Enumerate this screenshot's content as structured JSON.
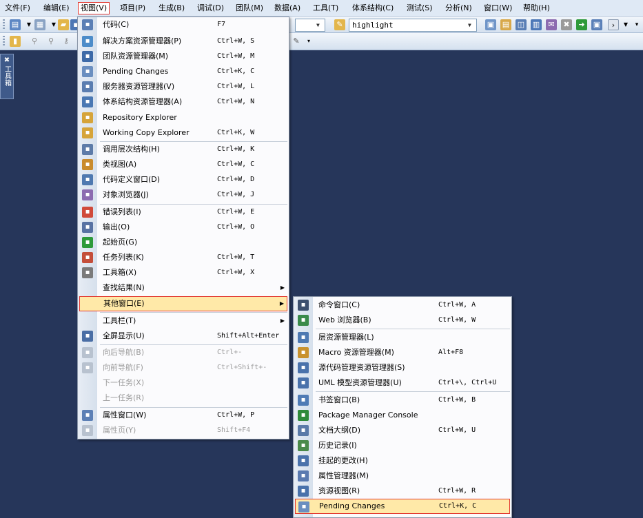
{
  "menubar": {
    "items": [
      "文件(F)",
      "编辑(E)",
      "视图(V)",
      "项目(P)",
      "生成(B)",
      "调试(D)",
      "团队(M)",
      "数据(A)",
      "工具(T)",
      "体系结构(C)",
      "测试(S)",
      "分析(N)",
      "窗口(W)",
      "帮助(H)"
    ]
  },
  "toolbar": {
    "find_value": "highlight",
    "first_combo_value": ""
  },
  "toolbox_tab": "工具箱",
  "view_menu": {
    "items": [
      {
        "label": "代码(C)",
        "shortcut": "F7",
        "icon": "code-icon",
        "color": "#5b7fb5"
      },
      {
        "label": "解决方案资源管理器(P)",
        "shortcut": "Ctrl+W, S",
        "icon": "solution-explorer-icon",
        "color": "#4d8cc9"
      },
      {
        "label": "团队资源管理器(M)",
        "shortcut": "Ctrl+W, M",
        "icon": "team-explorer-icon",
        "color": "#3d6aa8"
      },
      {
        "label": "Pending Changes",
        "shortcut": "Ctrl+K, C",
        "icon": "pending-changes-icon",
        "color": "#6b8fc0"
      },
      {
        "label": "服务器资源管理器(V)",
        "shortcut": "Ctrl+W, L",
        "icon": "server-explorer-icon",
        "color": "#5a7db0"
      },
      {
        "label": "体系结构资源管理器(A)",
        "shortcut": "Ctrl+W, N",
        "icon": "architecture-explorer-icon",
        "color": "#4a78b3"
      },
      {
        "label": "Repository Explorer",
        "shortcut": "",
        "icon": "repository-explorer-icon",
        "color": "#d6a43a"
      },
      {
        "label": "Working Copy Explorer",
        "shortcut": "Ctrl+K, W",
        "icon": "working-copy-icon",
        "color": "#d6a43a"
      },
      {
        "label": "调用层次结构(H)",
        "shortcut": "Ctrl+W, K",
        "icon": "call-hierarchy-icon",
        "color": "#5d7ba8"
      },
      {
        "label": "类视图(A)",
        "shortcut": "Ctrl+W, C",
        "icon": "class-view-icon",
        "color": "#c98b2d"
      },
      {
        "label": "代码定义窗口(D)",
        "shortcut": "Ctrl+W, D",
        "icon": "code-definition-icon",
        "color": "#4f79b0"
      },
      {
        "label": "对象浏览器(J)",
        "shortcut": "Ctrl+W, J",
        "icon": "object-browser-icon",
        "color": "#8c6bb0"
      },
      {
        "label": "错误列表(I)",
        "shortcut": "Ctrl+W, E",
        "icon": "error-list-icon",
        "color": "#d04a3a"
      },
      {
        "label": "输出(O)",
        "shortcut": "Ctrl+W, O",
        "icon": "output-icon",
        "color": "#5872a3"
      },
      {
        "label": "起始页(G)",
        "shortcut": "",
        "icon": "start-page-icon",
        "color": "#2e9a3a"
      },
      {
        "label": "任务列表(K)",
        "shortcut": "Ctrl+W, T",
        "icon": "task-list-icon",
        "color": "#c44e3a"
      },
      {
        "label": "工具箱(X)",
        "shortcut": "Ctrl+W, X",
        "icon": "toolbox-icon",
        "color": "#7a7a7a"
      },
      {
        "label": "查找结果(N)",
        "shortcut": "",
        "icon": "",
        "color": ""
      },
      {
        "label": "其他窗口(E)",
        "shortcut": "",
        "icon": "",
        "color": ""
      },
      {
        "label": "工具栏(T)",
        "shortcut": "",
        "icon": "",
        "color": ""
      },
      {
        "label": "全屏显示(U)",
        "shortcut": "Shift+Alt+Enter",
        "icon": "full-screen-icon",
        "color": "#4a6ea5"
      },
      {
        "label": "向后导航(B)",
        "shortcut": "Ctrl+-",
        "icon": "navigate-back-icon",
        "color": "#b8c2cf"
      },
      {
        "label": "向前导航(F)",
        "shortcut": "Ctrl+Shift+-",
        "icon": "navigate-forward-icon",
        "color": "#b8c2cf"
      },
      {
        "label": "下一任务(X)",
        "shortcut": "",
        "icon": "",
        "color": ""
      },
      {
        "label": "上一任务(R)",
        "shortcut": "",
        "icon": "",
        "color": ""
      },
      {
        "label": "属性窗口(W)",
        "shortcut": "Ctrl+W, P",
        "icon": "properties-window-icon",
        "color": "#5d80b5"
      },
      {
        "label": "属性页(Y)",
        "shortcut": "Shift+F4",
        "icon": "property-pages-icon",
        "color": "#b8c2cf"
      }
    ]
  },
  "other_windows_menu": {
    "items": [
      {
        "label": "命令窗口(C)",
        "shortcut": "Ctrl+W, A",
        "icon": "command-window-icon",
        "color": "#3c4f6e"
      },
      {
        "label": "Web 浏览器(B)",
        "shortcut": "Ctrl+W, W",
        "icon": "web-browser-icon",
        "color": "#3a8a4a"
      },
      {
        "label": "层资源管理器(L)",
        "shortcut": "",
        "icon": "layer-explorer-icon",
        "color": "#4e79b2"
      },
      {
        "label": "Macro 资源管理器(M)",
        "shortcut": "Alt+F8",
        "icon": "macro-explorer-icon",
        "color": "#c9922e"
      },
      {
        "label": "源代码管理资源管理器(S)",
        "shortcut": "",
        "icon": "source-control-icon",
        "color": "#4a72ab"
      },
      {
        "label": "UML 模型资源管理器(U)",
        "shortcut": "Ctrl+\\, Ctrl+U",
        "icon": "uml-explorer-icon",
        "color": "#4a72ab"
      },
      {
        "label": "书签窗口(B)",
        "shortcut": "Ctrl+W, B",
        "icon": "bookmark-window-icon",
        "color": "#4f7bb5"
      },
      {
        "label": "Package Manager Console",
        "shortcut": "",
        "icon": "package-console-icon",
        "color": "#2e8a3a"
      },
      {
        "label": "文档大纲(D)",
        "shortcut": "Ctrl+W, U",
        "icon": "document-outline-icon",
        "color": "#5a7aa8"
      },
      {
        "label": "历史记录(I)",
        "shortcut": "",
        "icon": "history-icon",
        "color": "#4a8a4a"
      },
      {
        "label": "挂起的更改(H)",
        "shortcut": "",
        "icon": "pending-changes-icon",
        "color": "#4a72ab"
      },
      {
        "label": "属性管理器(M)",
        "shortcut": "",
        "icon": "property-manager-icon",
        "color": "#5a7ab0"
      },
      {
        "label": "资源视图(R)",
        "shortcut": "Ctrl+W, R",
        "icon": "resource-view-icon",
        "color": "#4a72ab"
      },
      {
        "label": "Pending Changes",
        "shortcut": "Ctrl+K, C",
        "icon": "pending-changes-icon",
        "color": "#6b8fc0"
      }
    ]
  }
}
